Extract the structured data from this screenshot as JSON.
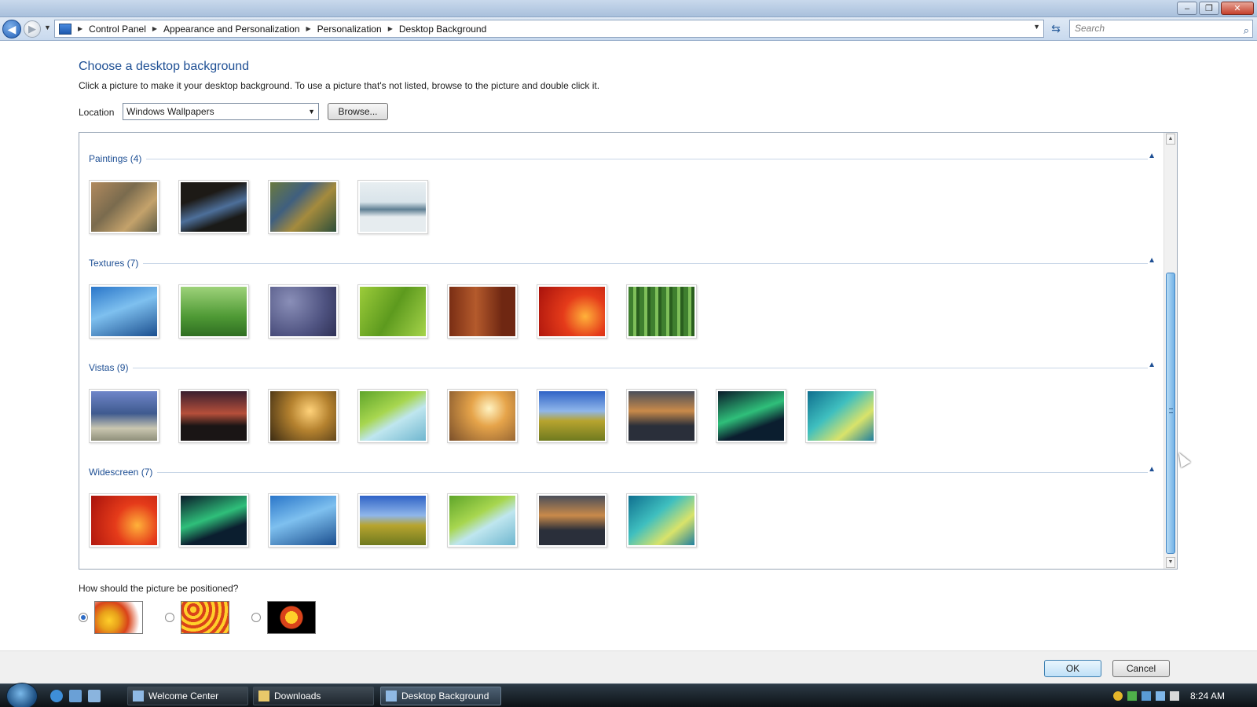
{
  "window": {
    "minimize": "–",
    "maximize": "❐",
    "close": "✕"
  },
  "nav": {
    "back": "◀",
    "forward": "▶",
    "recent": "▼",
    "breadcrumbs": [
      "Control Panel",
      "Appearance and Personalization",
      "Personalization",
      "Desktop Background"
    ],
    "refresh": "⇆",
    "search_placeholder": "Search",
    "search_icon": "⌕"
  },
  "main": {
    "heading": "Choose a desktop background",
    "instructions": "Click a picture to make it your desktop background. To use a picture that's not listed, browse to the picture and double click it.",
    "location_label": "Location",
    "location_value": "Windows Wallpapers",
    "browse_label": "Browse...",
    "groups": [
      {
        "title": "Paintings (4)",
        "items": [
          "painting-1",
          "painting-2",
          "painting-3",
          "painting-4"
        ]
      },
      {
        "title": "Textures (7)",
        "items": [
          "texture-1",
          "texture-2",
          "texture-3",
          "texture-4",
          "texture-5",
          "texture-6",
          "texture-7"
        ]
      },
      {
        "title": "Vistas (9)",
        "items": [
          "vista-1",
          "vista-2",
          "vista-3",
          "vista-4",
          "vista-5",
          "vista-6",
          "vista-7",
          "vista-8",
          "vista-9"
        ]
      },
      {
        "title": "Widescreen (7)",
        "items": [
          "wide-1",
          "wide-2",
          "wide-3",
          "wide-4",
          "wide-5",
          "wide-6",
          "wide-7"
        ]
      }
    ],
    "position_question": "How should the picture be positioned?",
    "position_options": [
      "fit",
      "tile",
      "center"
    ],
    "position_selected": "fit"
  },
  "footer": {
    "ok": "OK",
    "cancel": "Cancel"
  },
  "taskbar": {
    "tasks": [
      "Welcome Center",
      "Downloads",
      "Desktop Background"
    ],
    "active_task": "Desktop Background",
    "clock": "8:24 AM"
  },
  "colors": {
    "accent": "#1e4f94",
    "scroll_thumb": "#72b2e6"
  }
}
